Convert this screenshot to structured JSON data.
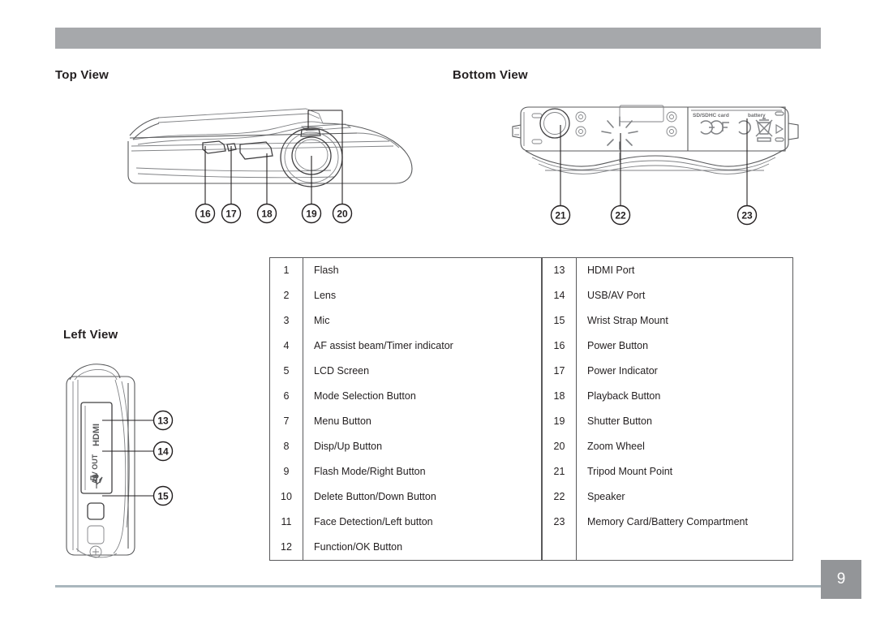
{
  "document": {
    "page_number": "9"
  },
  "sections": {
    "top_view": {
      "heading": "Top View"
    },
    "bottom_view": {
      "heading": "Bottom View"
    },
    "left_view": {
      "heading": "Left View"
    }
  },
  "figures": {
    "top_view": {
      "callouts": [
        "16",
        "17",
        "18",
        "19",
        "20"
      ]
    },
    "bottom_view": {
      "callouts": [
        "21",
        "22",
        "23"
      ],
      "labels": {
        "card_slot": "SD/SDHC card",
        "battery": "battery",
        "ce_mark": "CE",
        "fcc_mark": "FC"
      }
    },
    "left_view": {
      "callouts": [
        "13",
        "14",
        "15"
      ],
      "labels": {
        "hdmi": "HDMI",
        "av_out": "A/V OUT"
      }
    }
  },
  "parts_table": {
    "left_column": [
      {
        "num": "1",
        "label": "Flash"
      },
      {
        "num": "2",
        "label": "Lens"
      },
      {
        "num": "3",
        "label": "Mic"
      },
      {
        "num": "4",
        "label": "AF assist beam/Timer indicator"
      },
      {
        "num": "5",
        "label": "LCD Screen"
      },
      {
        "num": "6",
        "label": "Mode Selection Button"
      },
      {
        "num": "7",
        "label": "Menu Button"
      },
      {
        "num": "8",
        "label": "Disp/Up Button"
      },
      {
        "num": "9",
        "label": "Flash Mode/Right Button"
      },
      {
        "num": "10",
        "label": "Delete Button/Down Button"
      },
      {
        "num": "11",
        "label": "Face Detection/Left button"
      },
      {
        "num": "12",
        "label": "Function/OK Button"
      }
    ],
    "right_column": [
      {
        "num": "13",
        "label": "HDMI Port"
      },
      {
        "num": "14",
        "label": "USB/AV Port"
      },
      {
        "num": "15",
        "label": "Wrist Strap Mount"
      },
      {
        "num": "16",
        "label": "Power Button"
      },
      {
        "num": "17",
        "label": "Power Indicator"
      },
      {
        "num": "18",
        "label": "Playback Button"
      },
      {
        "num": "19",
        "label": "Shutter Button"
      },
      {
        "num": "20",
        "label": "Zoom Wheel"
      },
      {
        "num": "21",
        "label": "Tripod Mount Point"
      },
      {
        "num": "22",
        "label": "Speaker"
      },
      {
        "num": "23",
        "label": "Memory Card/Battery Compartment"
      }
    ]
  },
  "colors": {
    "header_band": "#a6a8ab",
    "page_box": "#939598",
    "footer_rule": "#aab7bd",
    "text": "#231f20"
  }
}
